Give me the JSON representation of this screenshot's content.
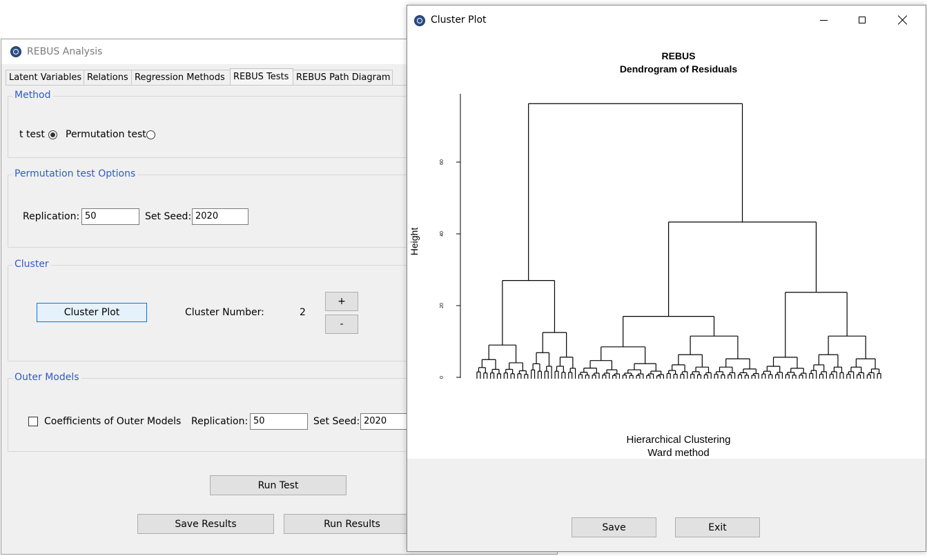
{
  "main_window": {
    "title": "REBUS Analysis",
    "tabs": [
      {
        "label": "Latent Variables",
        "active": false
      },
      {
        "label": "Relations",
        "active": false
      },
      {
        "label": "Regression Methods",
        "active": false
      },
      {
        "label": "REBUS Tests",
        "active": true
      },
      {
        "label": "REBUS Path Diagram",
        "active": false
      }
    ],
    "method": {
      "title": "Method",
      "t_test_label": "t test",
      "t_test_selected": true,
      "permutation_label": "Permutation test",
      "permutation_selected": false
    },
    "permutation_options": {
      "title": "Permutation test Options",
      "replication_label": "Replication:",
      "replication_value": "50",
      "seed_label": "Set Seed:",
      "seed_value": "2020"
    },
    "cluster": {
      "title": "Cluster",
      "plot_button": "Cluster Plot",
      "number_label": "Cluster Number:",
      "number_value": "2",
      "plus_label": "+",
      "minus_label": "-"
    },
    "outer_models": {
      "title": "Outer Models",
      "checkbox_label": "Coefficients of Outer Models",
      "checked": false,
      "replication_label": "Replication:",
      "replication_value": "50",
      "seed_label": "Set Seed:",
      "seed_value": "2020"
    },
    "buttons": {
      "run_test": "Run Test",
      "save_results": "Save Results",
      "run_results": "Run Results"
    }
  },
  "cluster_window": {
    "title": "Cluster Plot",
    "save_button": "Save",
    "exit_button": "Exit"
  },
  "chart_data": {
    "type": "dendrogram",
    "title": "REBUS",
    "subtitle": "Dendrogram of Residuals",
    "xlabel": "Hierarchical Clustering",
    "xlabel2": "Ward method",
    "ylabel": "Height",
    "y_tick_values": [
      0,
      20,
      40,
      60
    ],
    "ylim": [
      0,
      79
    ],
    "leaf_count": 120,
    "major_merges": [
      {
        "height": 76.3,
        "description": "root: left cluster + right super-cluster"
      },
      {
        "height": 43.3,
        "description": "right super-cluster"
      },
      {
        "height": 27.0,
        "description": "left cluster"
      },
      {
        "height": 23.7,
        "description": "rightmost cluster"
      },
      {
        "height": 17.0,
        "description": "middle cluster"
      }
    ],
    "line_color": "#000000"
  }
}
